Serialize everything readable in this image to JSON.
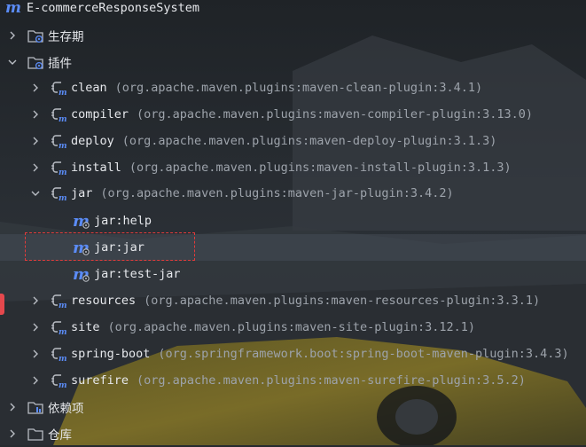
{
  "root": {
    "icon": "maven-icon",
    "label": "E-commerceResponseSystem"
  },
  "lifecycle": {
    "label": "生存期"
  },
  "plugins_folder": {
    "label": "插件"
  },
  "plugins": [
    {
      "name": "clean",
      "coords": "(org.apache.maven.plugins:maven-clean-plugin:3.4.1)"
    },
    {
      "name": "compiler",
      "coords": "(org.apache.maven.plugins:maven-compiler-plugin:3.13.0)"
    },
    {
      "name": "deploy",
      "coords": "(org.apache.maven.plugins:maven-deploy-plugin:3.1.3)"
    },
    {
      "name": "install",
      "coords": "(org.apache.maven.plugins:maven-install-plugin:3.1.3)"
    },
    {
      "name": "jar",
      "coords": "(org.apache.maven.plugins:maven-jar-plugin:3.4.2)",
      "expanded": true
    },
    {
      "name": "resources",
      "coords": "(org.apache.maven.plugins:maven-resources-plugin:3.3.1)"
    },
    {
      "name": "site",
      "coords": "(org.apache.maven.plugins:maven-site-plugin:3.12.1)"
    },
    {
      "name": "spring-boot",
      "coords": "(org.springframework.boot:spring-boot-maven-plugin:3.4.3)"
    },
    {
      "name": "surefire",
      "coords": "(org.apache.maven.plugins:maven-surefire-plugin:3.5.2)"
    }
  ],
  "jar_goals": [
    "jar:help",
    "jar:jar",
    "jar:test-jar"
  ],
  "selected_goal": "jar:jar",
  "dependencies": {
    "label": "依赖项"
  },
  "repositories": {
    "label": "仓库"
  },
  "colors": {
    "maven_blue": "#5b8cf7",
    "text": "#e6e8ec",
    "muted": "#9da3ab",
    "highlight_border": "#e23b3b"
  }
}
